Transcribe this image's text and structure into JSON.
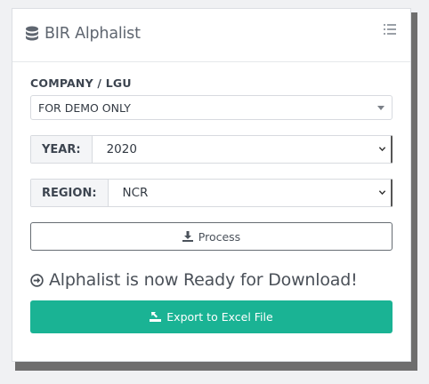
{
  "header": {
    "title": "BIR Alphalist",
    "title_icon": "database-icon",
    "menu_icon": "list-icon"
  },
  "company": {
    "label": "COMPANY / LGU",
    "selected": "FOR DEMO ONLY"
  },
  "year": {
    "label": "YEAR:",
    "selected": "2020"
  },
  "region": {
    "label": "REGION:",
    "selected": "NCR"
  },
  "process_button": {
    "label": "Process",
    "icon": "download-icon"
  },
  "status": {
    "message": "Alphalist is now Ready for Download!",
    "icon": "arrow-circle-right-icon"
  },
  "export_button": {
    "label": "Export to Excel File",
    "icon": "export-icon",
    "color": "#1ab394"
  }
}
